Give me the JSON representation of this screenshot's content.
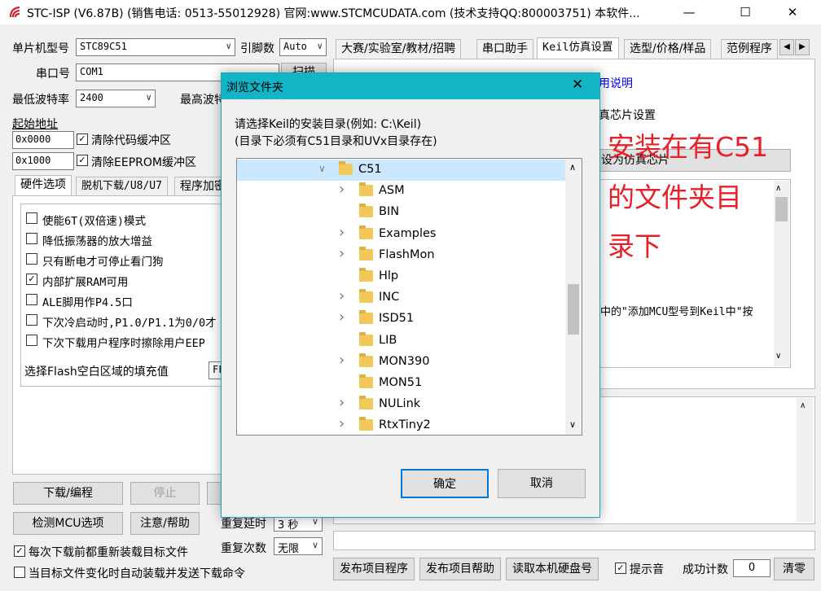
{
  "window": {
    "title": "STC-ISP (V6.87B) (销售电话: 0513-55012928) 官网:www.STCMCUDATA.com  (技术支持QQ:800003751) 本软件...",
    "minimize_icon": "minimize-icon",
    "maximize_icon": "maximize-icon",
    "close_icon": "close-icon"
  },
  "left": {
    "mcu_label": "单片机型号",
    "mcu_value": "STC89C51",
    "pin_label": "引脚数",
    "pin_value": "Auto",
    "port_label": "串口号",
    "port_value": "COM1",
    "scan_button": "扫描",
    "min_baud_label": "最低波特率",
    "min_baud_value": "2400",
    "max_baud_label": "最高波特",
    "start_addr_label": "起始地址",
    "addr1": "0x0000",
    "clear_code_label": "清除代码缓冲区",
    "addr2": "0x1000",
    "clear_eeprom_label": "清除EEPROM缓冲区",
    "tabs": [
      "硬件选项",
      "脱机下载/U8/U7",
      "程序加密"
    ],
    "options": [
      {
        "label": "使能6T(双倍速)模式",
        "checked": false
      },
      {
        "label": "降低振荡器的放大增益",
        "checked": false
      },
      {
        "label": "只有断电才可停止看门狗",
        "checked": false
      },
      {
        "label": "内部扩展RAM可用",
        "checked": true
      },
      {
        "label": "ALE脚用作P4.5口",
        "checked": false
      },
      {
        "label": "下次冷启动时,P1.0/P1.1为0/0才",
        "checked": false
      },
      {
        "label": "下次下载用户程序时擦除用户EEP",
        "checked": false
      }
    ],
    "fill_label": "选择Flash空白区域的填充值",
    "fill_value": "FF",
    "download_button": "下载/编程",
    "stop_button": "停止",
    "detect_button": "检测MCU选项",
    "help_button": "注意/帮助",
    "reload_label": "每次下载前都重新装载目标文件",
    "reload_checked": true,
    "autoload_label": "当目标文件变化时自动装载并发送下载命令",
    "autoload_checked": false,
    "delay_label": "重复延时",
    "delay_value": "3 秒",
    "repeat_label": "重复次数",
    "repeat_value": "无限"
  },
  "right": {
    "tabs": [
      "大赛/实验室/教材/招聘",
      "串口助手",
      "Keil仿真设置",
      "选型/价格/样品",
      "范例程序"
    ],
    "active_tab": 2,
    "help_link": "用说明",
    "chip_settings": "真芯片设置",
    "set_chip_button": "设为仿真芯片",
    "info_text": "中的\"添加MCU型号到Keil中\"按",
    "publish_button": "发布项目程序",
    "publish_help_button": "发布项目帮助",
    "read_disk_button": "读取本机硬盘号",
    "prompt_label": "提示音",
    "prompt_checked": true,
    "success_label": "成功计数",
    "success_value": "0",
    "clear_button": "清零"
  },
  "annotation": {
    "lines": [
      "安装在有C51",
      "的文件夹目",
      "录下"
    ]
  },
  "dialog": {
    "title": "浏览文件夹",
    "line1": "请选择Keil的安装目录(例如: C:\\Keil)",
    "line2": "(目录下必须有C51目录和UVx目录存在)",
    "folders": [
      {
        "name": "C51",
        "expanded": true,
        "level": 0,
        "has_children": true
      },
      {
        "name": "ASM",
        "level": 1,
        "has_children": true
      },
      {
        "name": "BIN",
        "level": 1,
        "has_children": false
      },
      {
        "name": "Examples",
        "level": 1,
        "has_children": true
      },
      {
        "name": "FlashMon",
        "level": 1,
        "has_children": true
      },
      {
        "name": "Hlp",
        "level": 1,
        "has_children": false
      },
      {
        "name": "INC",
        "level": 1,
        "has_children": true
      },
      {
        "name": "ISD51",
        "level": 1,
        "has_children": true
      },
      {
        "name": "LIB",
        "level": 1,
        "has_children": false
      },
      {
        "name": "MON390",
        "level": 1,
        "has_children": true
      },
      {
        "name": "MON51",
        "level": 1,
        "has_children": false
      },
      {
        "name": "NULink",
        "level": 1,
        "has_children": true
      },
      {
        "name": "RtxTiny2",
        "level": 1,
        "has_children": true
      }
    ],
    "ok_button": "确定",
    "cancel_button": "取消"
  },
  "colors": {
    "dialog_title_bg": "#14b4c7",
    "annotation_text": "#e8202a",
    "link": "#0000ee",
    "folder": "#f2c85b"
  }
}
